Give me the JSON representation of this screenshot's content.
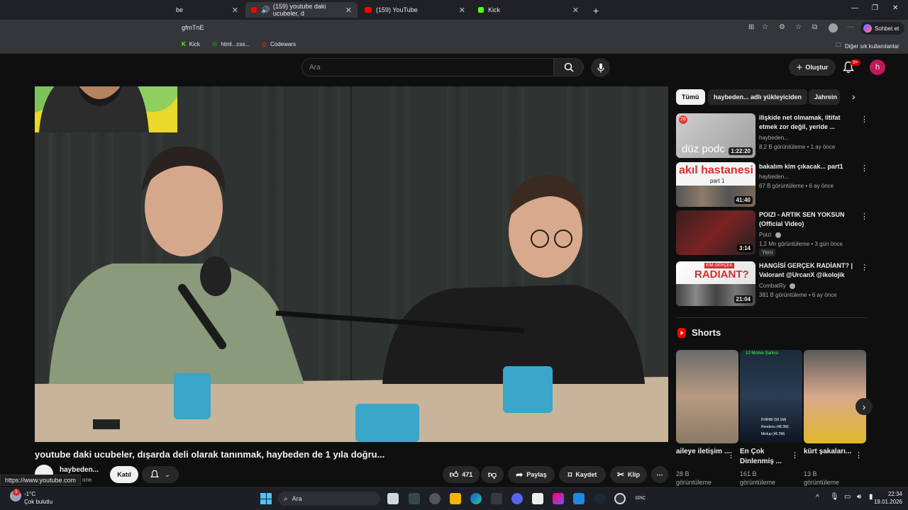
{
  "browser": {
    "tabs": [
      {
        "label": "be",
        "active": false
      },
      {
        "label": "(159) youtube daki ucubeler, d",
        "active": true
      },
      {
        "label": "(159) YouTube",
        "active": false
      },
      {
        "label": "Kick",
        "active": false
      }
    ],
    "new_tab": "+",
    "url": "gfmTnE",
    "profile_button": "Sohbet et",
    "bookmarks": [
      {
        "label": "Kick",
        "glyph": "K"
      },
      {
        "label": "html...css...",
        "glyph": "W"
      },
      {
        "label": "Codewars",
        "glyph": "◎"
      }
    ],
    "other_bookmarks": "Diğer sık kullanılanlar",
    "window_controls": [
      "—",
      "❐",
      "✕"
    ]
  },
  "youtube": {
    "search_placeholder": "Ara",
    "create_label": "Oluştur",
    "notifications_badge": "9+",
    "avatar_letter": "h",
    "video": {
      "title": "youtube daki ucubeler, dışarda deli olarak tanınmak, haybeden de 1 yıla doğru...",
      "channel": "haybeden...",
      "subs_fragment": "one",
      "join_label": "Katıl",
      "likes": "471",
      "share_label": "Paylaş",
      "save_label": "Kaydet",
      "clip_label": "Klip",
      "more": "⋯"
    },
    "status_url": "https://www.youtube.com",
    "chips": [
      {
        "label": "Tümü",
        "active": true
      },
      {
        "label": "haybeden... adlı yükleyiciden",
        "active": false
      },
      {
        "label": "Jahrein",
        "active": false
      }
    ],
    "recommendations": [
      {
        "title": "ilişkide net olmamak, iltifat etmek zor değil, yeride ...",
        "channel": "haybeden...",
        "meta": "8,2 B görüntüleme • 1 ay önce",
        "duration": "1:22:20",
        "thumb_text": "düz podc",
        "badge_num": "28"
      },
      {
        "title": "bakalım kim çıkacak... part1",
        "channel": "haybeden...",
        "meta": "67 B görüntüleme • 6 ay önce",
        "duration": "41:40",
        "thumb_text": "akıl hastanesi",
        "thumb_sub": "part 1"
      },
      {
        "title": "POIZI - ARTIK SEN YOKSUN (Official Video)",
        "channel": "Poizi",
        "meta": "1,2 Mn görüntüleme • 3 gün önce",
        "duration": "3:14",
        "new_badge": "Yeni"
      },
      {
        "title": "HANGİSİ GERÇEK RADİANT? | Valorant @UrcanX @ikolojik",
        "channel": "CombatRy",
        "meta": "381 B görüntüleme • 6 ay önce",
        "duration": "21:04",
        "thumb_text": "RADIANT?",
        "thumb_sub": "KİM GERÇEK"
      }
    ],
    "shorts_heading": "Shorts",
    "shorts": [
      {
        "title": "aileye iletişim ...",
        "views": "28 B görüntüleme"
      },
      {
        "title": "En Çok Dinlenmiş ...",
        "views": "161 B görüntüleme",
        "overlay": "10 Motive Şarkısı",
        "list": [
          "KHRIBI (50.1M)",
          "Rendevu (48.3M)",
          "Mixtup (46.2M)"
        ]
      },
      {
        "title": "kürt şakaları...",
        "views": "13 B görüntüleme"
      }
    ]
  },
  "taskbar": {
    "weather_temp": "-1°C",
    "weather_desc": "Çok bulutlu",
    "search_label": "Ara",
    "time": "22:34",
    "date": "19.01.2026",
    "notif_count": "5"
  },
  "colors": {
    "bg": "#0f0f0f",
    "chip": "#272727",
    "accent_red": "#cc0000",
    "avatar": "#c2185b"
  }
}
